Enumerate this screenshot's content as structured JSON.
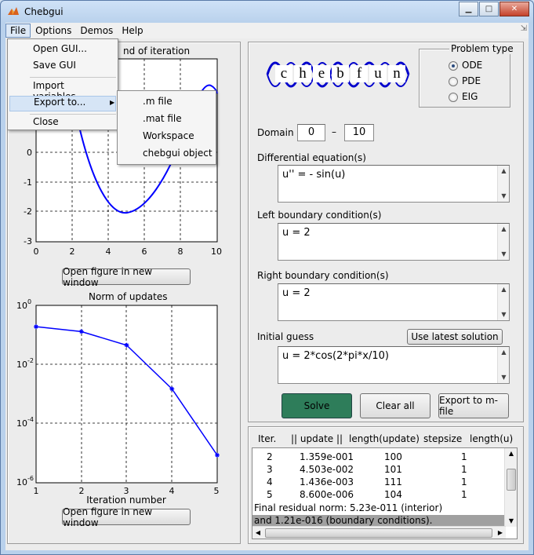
{
  "window": {
    "title": "Chebgui"
  },
  "menubar": {
    "items": [
      "File",
      "Options",
      "Demos",
      "Help"
    ]
  },
  "file_menu": {
    "items": [
      "Open GUI...",
      "Save GUI",
      "Import variables...",
      "Export to...",
      "Close"
    ],
    "export_submenu": [
      ".m file",
      ".mat file",
      "Workspace",
      "chebgui object"
    ]
  },
  "plot1": {
    "title_visible": "nd of iteration",
    "xticks": [
      "0",
      "2",
      "4",
      "6",
      "8",
      "10"
    ],
    "yticks": [
      "0",
      "-1",
      "-2",
      "-3"
    ],
    "button": "Open figure in new window"
  },
  "plot2": {
    "title": "Norm of updates",
    "xlabel": "Iteration number",
    "xticks": [
      "1",
      "2",
      "3",
      "4",
      "5"
    ],
    "yticks": [
      "10",
      "10",
      "10",
      "10"
    ],
    "yexp": [
      "0",
      "-2",
      "-4",
      "-6"
    ],
    "button": "Open figure in new window"
  },
  "chart_data": {
    "type": "line",
    "x": [
      1,
      2,
      3,
      4,
      5
    ],
    "values": [
      0.19,
      0.13,
      0.045,
      0.0015,
      8.6e-06
    ],
    "title": "Norm of updates",
    "xlabel": "Iteration number",
    "yscale": "log",
    "xlim": [
      1,
      5
    ],
    "ylim": [
      1e-06,
      1
    ],
    "color": "#0000ff"
  },
  "logo": {
    "letters": [
      "c",
      "h",
      "e",
      "b",
      "f",
      "u",
      "n"
    ]
  },
  "problem_type": {
    "title": "Problem type",
    "options": [
      "ODE",
      "PDE",
      "EIG"
    ],
    "selected": "ODE"
  },
  "domain": {
    "label": "Domain",
    "start": "0",
    "dash": "–",
    "end": "10"
  },
  "de": {
    "label": "Differential equation(s)",
    "value": "u'' = - sin(u)"
  },
  "lbc": {
    "label": "Left boundary condition(s)",
    "value": "u = 2"
  },
  "rbc": {
    "label": "Right boundary condition(s)",
    "value": "u = 2"
  },
  "guess": {
    "label": "Initial guess",
    "value": "u = 2*cos(2*pi*x/10)",
    "button": "Use latest solution"
  },
  "actions": {
    "solve": "Solve",
    "clear": "Clear all",
    "export": "Export to m-file"
  },
  "iter_table": {
    "headers": [
      "Iter.",
      "|| update ||",
      "length(update)",
      "stepsize",
      "length(u)"
    ],
    "rows": [
      [
        "2",
        "1.359e-001",
        "100",
        "1"
      ],
      [
        "3",
        "4.503e-002",
        "101",
        "1"
      ],
      [
        "4",
        "1.436e-003",
        "111",
        "1"
      ],
      [
        "5",
        "8.600e-006",
        "104",
        "1"
      ]
    ],
    "footer1": "Final residual norm: 5.23e-011 (interior)",
    "footer2": "and 1.21e-016 (boundary conditions)."
  },
  "colors": {
    "solve_bg": "#2e7d5a",
    "line": "#0000ff",
    "highlight": "#a0a0a0"
  }
}
